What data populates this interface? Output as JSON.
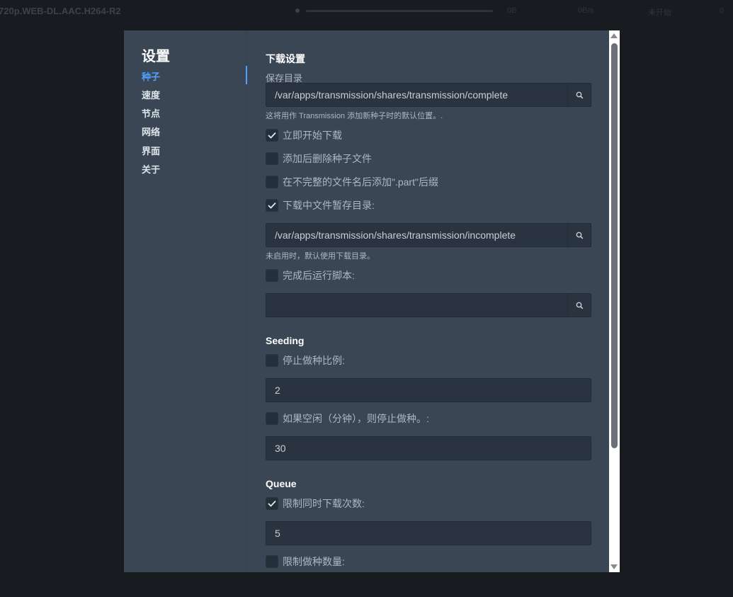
{
  "background": {
    "title": "720p.WEB-DL.AAC.H264-R2",
    "t1": "0B",
    "t2": "0B/s",
    "t3": "未开始",
    "t4": "0"
  },
  "sidebar": {
    "title": "设置",
    "items": [
      {
        "label": "种子",
        "active": true
      },
      {
        "label": "速度"
      },
      {
        "label": "节点"
      },
      {
        "label": "网络"
      },
      {
        "label": "界面"
      },
      {
        "label": "关于"
      }
    ]
  },
  "download": {
    "section_title": "下载设置",
    "save_dir_label": "保存目录",
    "save_dir_value": "/var/apps/transmission/shares/transmission/complete",
    "save_dir_hint": "这将用作 Transmission 添加新种子时的默认位置。.",
    "start_now": {
      "label": "立即开始下载",
      "checked": true
    },
    "delete_torrent": {
      "label": "添加后删除种子文件",
      "checked": false
    },
    "part_suffix": {
      "label": "在不完整的文件名后添加\".part\"后缀",
      "checked": false
    },
    "incomplete_dir": {
      "label": "下载中文件暂存目录:",
      "checked": true
    },
    "incomplete_dir_value": "/var/apps/transmission/shares/transmission/incomplete",
    "incomplete_dir_hint": "未启用时，默认使用下载目录。",
    "run_script": {
      "label": "完成后运行脚本:",
      "checked": false
    },
    "script_value": ""
  },
  "seeding": {
    "section_title": "Seeding",
    "ratio": {
      "label": "停止做种比例:",
      "checked": false
    },
    "ratio_value": "2",
    "idle": {
      "label": "如果空闲（分钟），则停止做种。:",
      "checked": false
    },
    "idle_value": "30"
  },
  "queue": {
    "section_title": "Queue",
    "download_limit": {
      "label": "限制同时下载次数:",
      "checked": true
    },
    "download_limit_value": "5",
    "seed_limit": {
      "label": "限制做种数量:",
      "checked": false
    }
  },
  "colors": {
    "accent": "#4da3ff",
    "dialog_bg": "#3a4653",
    "input_bg": "#2a3440"
  }
}
